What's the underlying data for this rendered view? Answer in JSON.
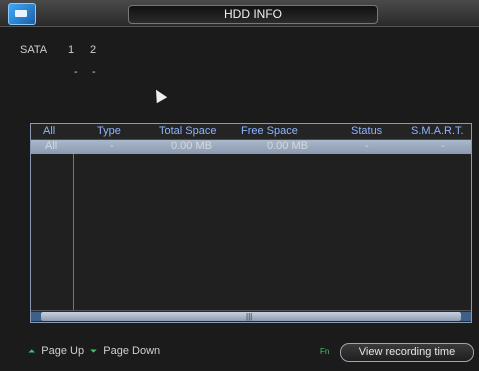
{
  "window": {
    "title": "HDD INFO"
  },
  "sata": {
    "label": "SATA",
    "ports": [
      "1",
      "2"
    ],
    "states": [
      "-",
      "-"
    ]
  },
  "table": {
    "headers": [
      "All",
      "Type",
      "Total Space",
      "Free Space",
      "Status",
      "S.M.A.R.T."
    ],
    "rows": [
      [
        "All",
        "-",
        "0.00 MB",
        "0.00 MB",
        "-",
        "-"
      ]
    ]
  },
  "footer": {
    "page_up": "Page Up",
    "page_down": "Page Down",
    "fn": "Fn",
    "view_recording_time": "View recording time"
  },
  "icons": [
    "app-icon",
    "mouse-cursor-icon",
    "page-up-icon",
    "page-down-icon",
    "fn-icon"
  ],
  "colors": {
    "accent": "#3ec66a",
    "header_text": "#8fb4ff",
    "selection_row": "#9aa8bd"
  }
}
